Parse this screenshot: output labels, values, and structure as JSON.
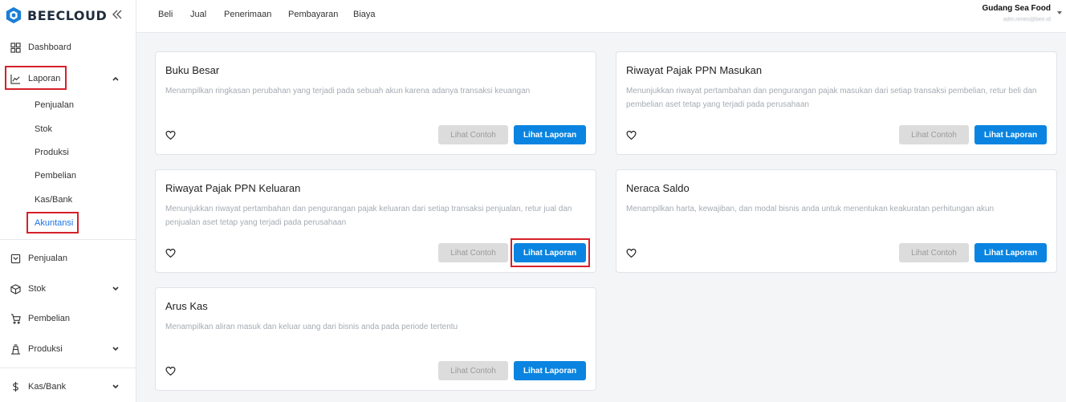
{
  "brand": {
    "name": "BEECLOUD"
  },
  "sidebar": {
    "items": [
      {
        "label": "Dashboard"
      },
      {
        "label": "Laporan"
      },
      {
        "label": "Penjualan"
      },
      {
        "label": "Stok"
      },
      {
        "label": "Pembelian"
      },
      {
        "label": "Produksi"
      },
      {
        "label": "Kas/Bank"
      }
    ],
    "laporan_sub": [
      {
        "label": "Penjualan"
      },
      {
        "label": "Stok"
      },
      {
        "label": "Produksi"
      },
      {
        "label": "Pembelian"
      },
      {
        "label": "Kas/Bank"
      },
      {
        "label": "Akuntansi"
      }
    ]
  },
  "topbar": {
    "links": [
      "Beli",
      "Jual",
      "Penerimaan",
      "Pembayaran",
      "Biaya"
    ],
    "company": "Gudang Sea Food",
    "email": "adm.renes@bee.id"
  },
  "cards": [
    {
      "title": "Buku Besar",
      "desc": "Menampilkan ringkasan perubahan yang terjadi pada sebuah akun karena adanya transaksi keuangan",
      "contoh_label": "Lihat Contoh",
      "laporan_label": "Lihat Laporan"
    },
    {
      "title": "Riwayat Pajak PPN Masukan",
      "desc": "Menunjukkan riwayat pertambahan dan pengurangan pajak masukan dari setiap transaksi pembelian, retur beli dan pembelian aset tetap yang terjadi pada perusahaan",
      "contoh_label": "Lihat Contoh",
      "laporan_label": "Lihat Laporan"
    },
    {
      "title": "Riwayat Pajak PPN Keluaran",
      "desc": "Menunjukkan riwayat pertambahan dan pengurangan pajak keluaran dari setiap transaksi penjualan, retur jual dan penjualan aset tetap yang terjadi pada perusahaan",
      "contoh_label": "Lihat Contoh",
      "laporan_label": "Lihat Laporan"
    },
    {
      "title": "Neraca Saldo",
      "desc": "Menampilkan harta, kewajiban, dan modal bisnis anda untuk menentukan keakuratan perhitungan akun",
      "contoh_label": "Lihat Contoh",
      "laporan_label": "Lihat Laporan"
    },
    {
      "title": "Arus Kas",
      "desc": "Menampilkan aliran masuk dan keluar uang dari bisnis anda pada periode tertentu",
      "contoh_label": "Lihat Contoh",
      "laporan_label": "Lihat Laporan"
    }
  ],
  "colors": {
    "accent": "#0a84e0",
    "highlight": "#d6202a",
    "active_link": "#1a73e8"
  }
}
